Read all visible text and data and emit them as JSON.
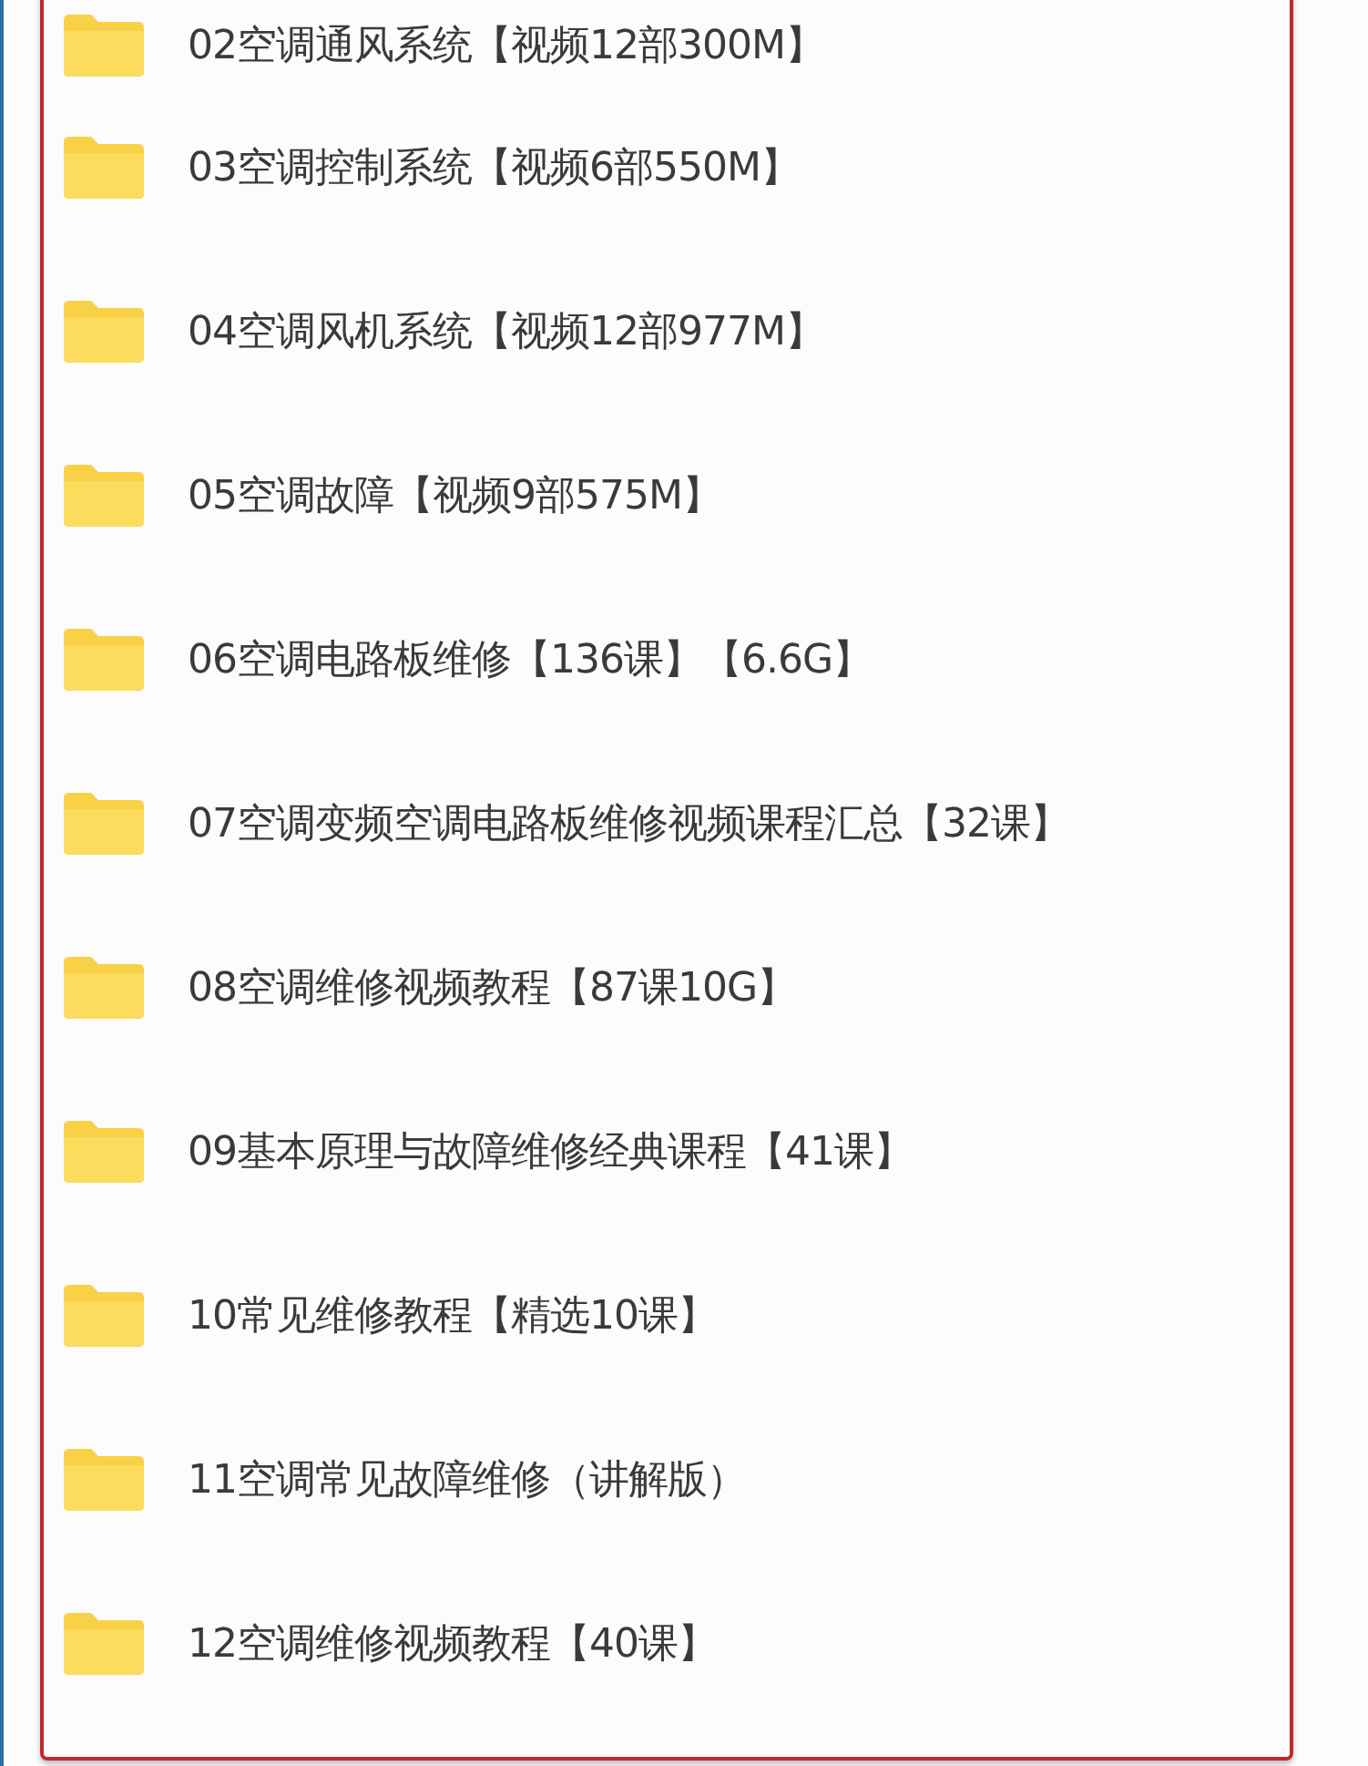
{
  "folders": [
    {
      "name": "02空调通风系统【视频12部300M】"
    },
    {
      "name": "03空调控制系统【视频6部550M】"
    },
    {
      "name": "04空调风机系统【视频12部977M】"
    },
    {
      "name": "05空调故障【视频9部575M】"
    },
    {
      "name": "06空调电路板维修【136课】【6.6G】"
    },
    {
      "name": "07空调变频空调电路板维修视频课程汇总【32课】"
    },
    {
      "name": "08空调维修视频教程【87课10G】"
    },
    {
      "name": "09基本原理与故障维修经典课程【41课】"
    },
    {
      "name": "10常见维修教程【精选10课】"
    },
    {
      "name": "11空调常见故障维修（讲解版）"
    },
    {
      "name": "12空调维修视频教程【40课】"
    }
  ]
}
